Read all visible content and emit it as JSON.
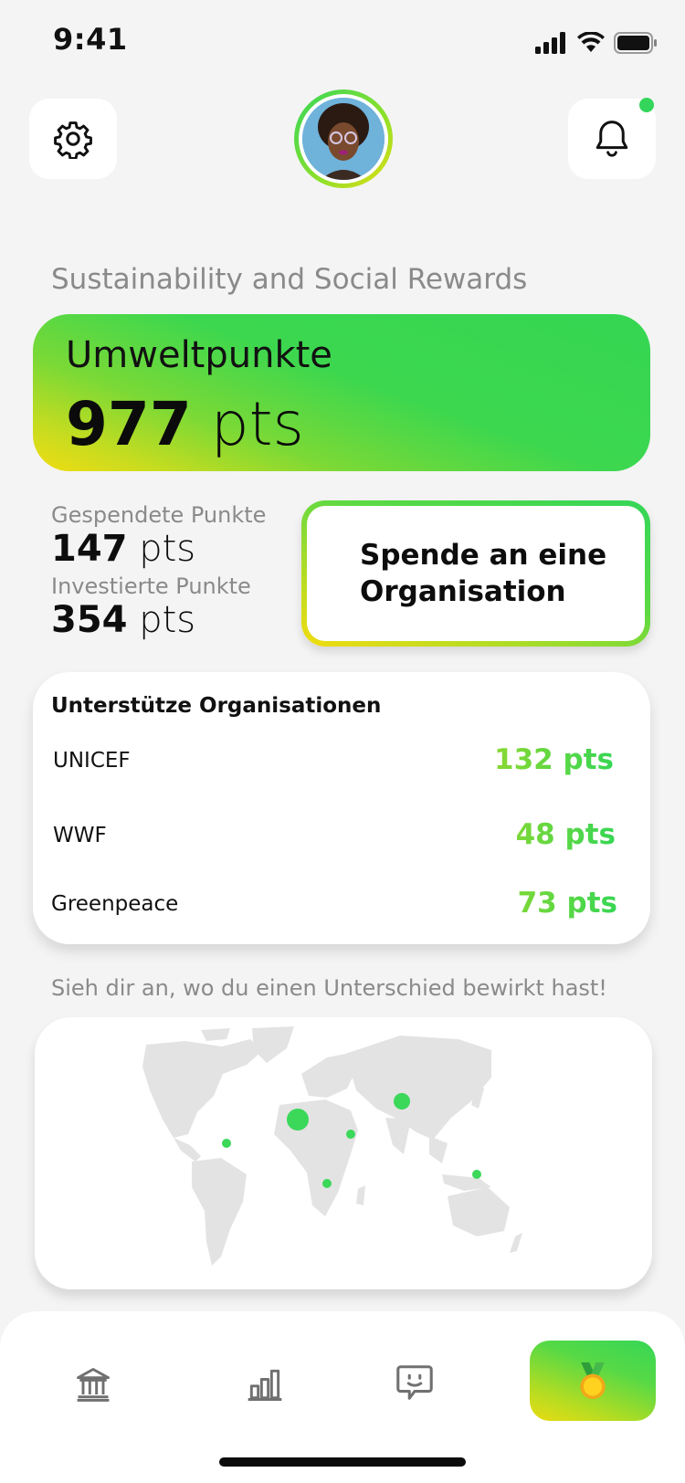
{
  "status_bar": {
    "time": "9:41"
  },
  "header": {
    "notification_dot_color": "#33d65a"
  },
  "section_title": "Sustainability and Social Rewards",
  "points_card": {
    "label": "Umweltpunkte",
    "value": "977",
    "unit": "pts"
  },
  "stats": {
    "donated_label": "Gespendete Punkte",
    "donated_value": "147",
    "donated_unit": "pts",
    "invested_label": "Investierte Punkte",
    "invested_value": "354",
    "invested_unit": "pts"
  },
  "donate_button": {
    "label_line1": "Spende an eine",
    "label_line2": "Organisation"
  },
  "organisations": {
    "title": "Unterstütze Organisationen",
    "items": [
      {
        "name": "UNICEF",
        "points": "132 pts"
      },
      {
        "name": "WWF",
        "points": "48 pts"
      },
      {
        "name": "Greenpeace",
        "points": "73 pts"
      }
    ]
  },
  "map": {
    "caption": "Sieh dir an, wo du einen Unterschied bewirkt hast!"
  },
  "nav": {
    "items": [
      "bank-icon",
      "chart-icon",
      "chat-icon",
      "medal-icon"
    ],
    "active": "medal-icon"
  },
  "colors": {
    "accent_green": "#35d654",
    "accent_yellow": "#f2dc10"
  }
}
